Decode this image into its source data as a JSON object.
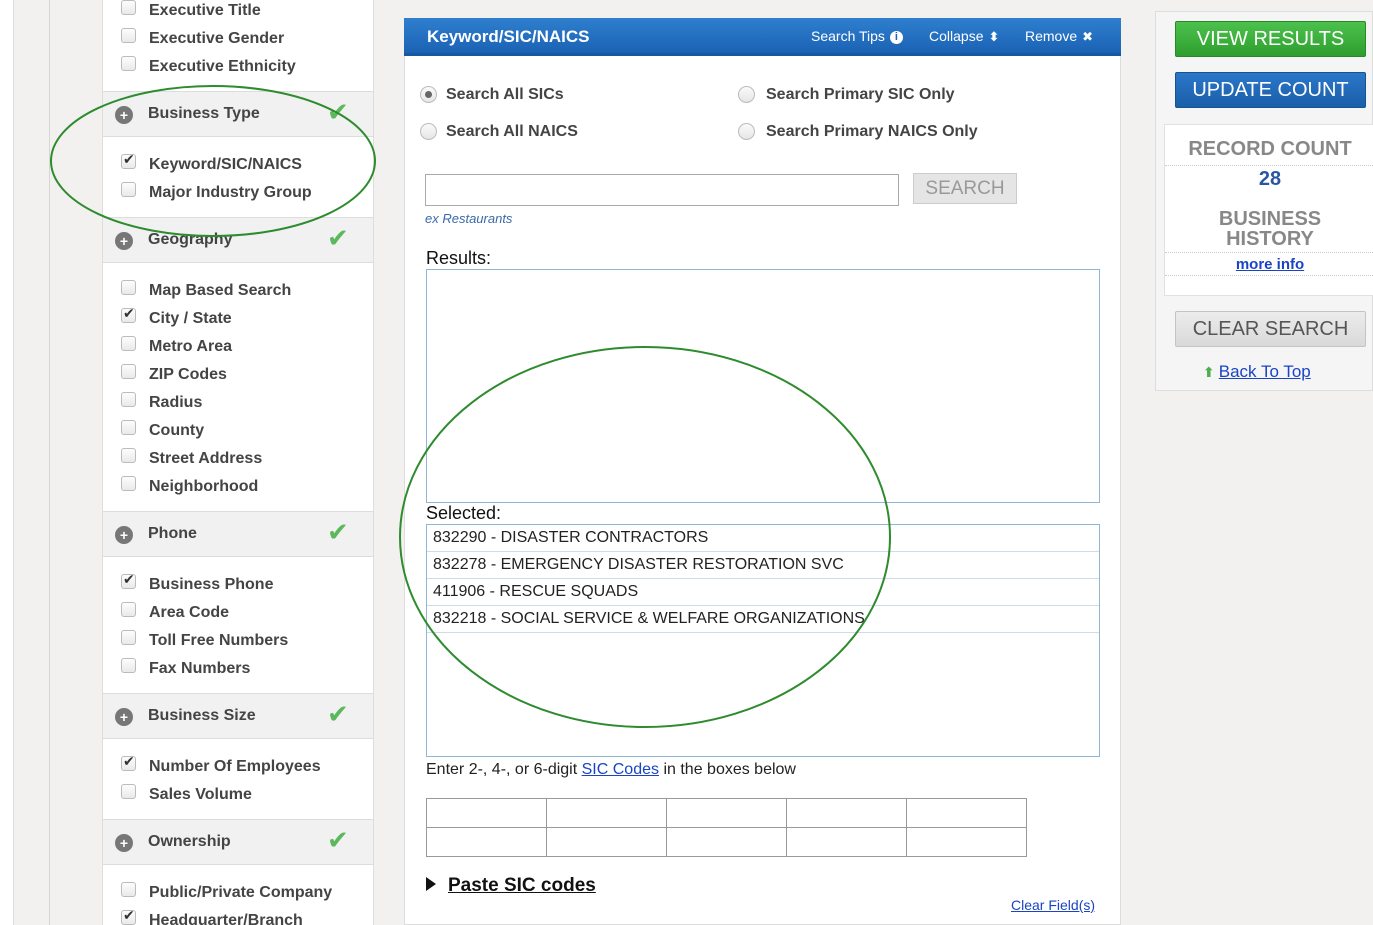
{
  "sidebar": {
    "top_items": [
      {
        "label": "Executive Title",
        "checked": false
      },
      {
        "label": "Executive Gender",
        "checked": false
      },
      {
        "label": "Executive Ethnicity",
        "checked": false
      }
    ],
    "sections": [
      {
        "title": "Business Type",
        "complete": true,
        "items": [
          {
            "label": "Keyword/SIC/NAICS",
            "checked": true
          },
          {
            "label": "Major Industry Group",
            "checked": false
          }
        ]
      },
      {
        "title": "Geography",
        "complete": true,
        "items": [
          {
            "label": "Map Based Search",
            "checked": false
          },
          {
            "label": "City / State",
            "checked": true
          },
          {
            "label": "Metro Area",
            "checked": false
          },
          {
            "label": "ZIP Codes",
            "checked": false
          },
          {
            "label": "Radius",
            "checked": false
          },
          {
            "label": "County",
            "checked": false
          },
          {
            "label": "Street Address",
            "checked": false
          },
          {
            "label": "Neighborhood",
            "checked": false
          }
        ]
      },
      {
        "title": "Phone",
        "complete": true,
        "items": [
          {
            "label": "Business Phone",
            "checked": true
          },
          {
            "label": "Area Code",
            "checked": false
          },
          {
            "label": "Toll Free Numbers",
            "checked": false
          },
          {
            "label": "Fax Numbers",
            "checked": false
          }
        ]
      },
      {
        "title": "Business Size",
        "complete": true,
        "items": [
          {
            "label": "Number Of Employees",
            "checked": true
          },
          {
            "label": "Sales Volume",
            "checked": false
          }
        ]
      },
      {
        "title": "Ownership",
        "complete": true,
        "items": [
          {
            "label": "Public/Private Company",
            "checked": false
          },
          {
            "label": "Headquarter/Branch",
            "checked": true
          }
        ]
      }
    ]
  },
  "panel": {
    "title": "Keyword/SIC/NAICS",
    "search_tips": "Search Tips",
    "search_tips_glyph": "i",
    "collapse": "Collapse",
    "collapse_glyph": "⬍",
    "remove": "Remove",
    "remove_glyph": "✖",
    "radios": [
      {
        "label": "Search All SICs",
        "checked": true
      },
      {
        "label": "Search Primary SIC Only",
        "checked": false
      },
      {
        "label": "Search All NAICS",
        "checked": false
      },
      {
        "label": "Search Primary NAICS Only",
        "checked": false
      }
    ],
    "search_value": "",
    "search_button": "SEARCH",
    "hint": "ex Restaurants",
    "results_label": "Results:",
    "selected_label": "Selected:",
    "selected": [
      "832290 - DISASTER CONTRACTORS",
      "832278 - EMERGENCY DISASTER RESTORATION SVC",
      "411906 - RESCUE SQUADS",
      "832218 - SOCIAL SERVICE & WELFARE ORGANIZATIONS"
    ],
    "enter_prefix": "Enter 2-, 4-, or 6-digit",
    "sic_codes_link": "SIC Codes",
    "enter_suffix": "in the boxes below",
    "paste_label": "Paste SIC codes",
    "clear_fields": "Clear Field(s)"
  },
  "right": {
    "view_results": "VIEW RESULTS",
    "update_count": "UPDATE COUNT",
    "record_count_label": "RECORD COUNT",
    "record_count": "28",
    "business_history_line1": "BUSINESS",
    "business_history_line2": "HISTORY",
    "more_info": "more info",
    "clear_search": "CLEAR SEARCH",
    "back_to_top": "Back To Top"
  },
  "colors": {
    "header_blue": "#1b62b4",
    "view_results_green": "#3cb03c",
    "update_count_blue": "#1e65b3",
    "annotation_green": "#2e8b2e",
    "check_green": "#5cb85c"
  }
}
